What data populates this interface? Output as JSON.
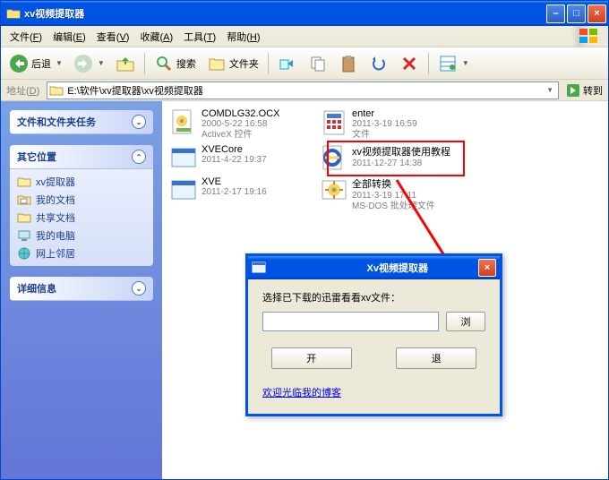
{
  "titlebar": {
    "title": "xv视频提取器"
  },
  "window_buttons": {
    "min": "–",
    "max": "□",
    "close": "×"
  },
  "menu": {
    "file": "文件",
    "file_k": "F",
    "edit": "编辑",
    "edit_k": "E",
    "view": "查看",
    "view_k": "V",
    "fav": "收藏",
    "fav_k": "A",
    "tool": "工具",
    "tool_k": "T",
    "help": "帮助",
    "help_k": "H"
  },
  "toolbar": {
    "back": "后退",
    "search": "搜索",
    "folders": "文件夹"
  },
  "address": {
    "label": "地址",
    "label_k": "D",
    "path": "E:\\软件\\xv提取器\\xv视频提取器",
    "go": "转到"
  },
  "sidebar": {
    "panel1": {
      "title": "文件和文件夹任务"
    },
    "panel2": {
      "title": "其它位置",
      "items": [
        {
          "icon": "folder",
          "label": "xv提取器"
        },
        {
          "icon": "docs",
          "label": "我的文档"
        },
        {
          "icon": "folder",
          "label": "共享文档"
        },
        {
          "icon": "computer",
          "label": "我的电脑"
        },
        {
          "icon": "network",
          "label": "网上邻居"
        }
      ]
    },
    "panel3": {
      "title": "详细信息"
    }
  },
  "files": [
    {
      "icon": "ocx",
      "name": "COMDLG32.OCX",
      "line2": "2000-5-22 16:58",
      "line3": "ActiveX 控件"
    },
    {
      "icon": "cfg",
      "name": "enter",
      "line2": "2011-3-19 16:59",
      "line3": "文件"
    },
    {
      "icon": "app",
      "name": "XVECore",
      "line2": "2011-4-22 19:37",
      "line3": ""
    },
    {
      "icon": "ie",
      "name": "xv视频提取器使用教程",
      "line2": "2011-12-27 14:38",
      "line3": ""
    },
    {
      "icon": "app",
      "name": "XVE",
      "line2": "2011-2-17 19:16",
      "line3": ""
    },
    {
      "icon": "bat",
      "name": "全部转换",
      "line2": "2011-3-19 17:11",
      "line3": "MS-DOS 批处理文件"
    }
  ],
  "dialog": {
    "title": "Xv视频提取器",
    "label": "选择已下载的迅雷看看xv文件：",
    "browse": "浏",
    "open": "开",
    "cancel": "退",
    "link": "欢迎光临我的博客"
  }
}
